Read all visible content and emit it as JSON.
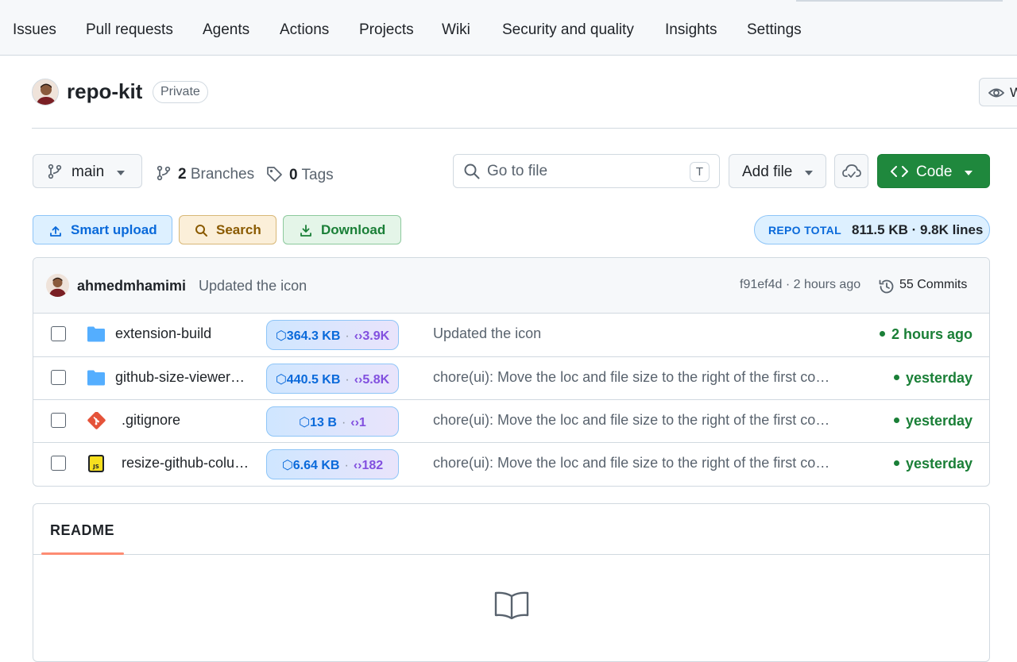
{
  "nav": {
    "items": [
      {
        "label": "Issues"
      },
      {
        "label": "Pull requests"
      },
      {
        "label": "Agents"
      },
      {
        "label": "Actions"
      },
      {
        "label": "Projects"
      },
      {
        "label": "Wiki"
      },
      {
        "label": "Security and quality"
      },
      {
        "label": "Insights"
      },
      {
        "label": "Settings"
      }
    ]
  },
  "repo": {
    "name": "repo-kit",
    "visibility": "Private",
    "watch_label": "W"
  },
  "toolbar": {
    "branch": "main",
    "branches_count": "2",
    "branches_label": "Branches",
    "tags_count": "0",
    "tags_label": "Tags",
    "goto_placeholder": "Go to file",
    "goto_shortcut": "T",
    "add_file": "Add file",
    "code": "Code"
  },
  "actions": {
    "smart_upload": "Smart upload",
    "search": "Search",
    "download": "Download",
    "repo_total_label": "REPO TOTAL",
    "repo_total_value": "811.5 KB · 9.8K lines"
  },
  "latest_commit": {
    "author": "ahmedmhamimi",
    "message": "Updated the icon",
    "sha_time": "f91ef4d · 2 hours ago",
    "commits": "55 Commits"
  },
  "files": [
    {
      "name": "extension-build",
      "type": "folder",
      "size": "364.3 KB",
      "loc": "3.9K",
      "commit": "Updated the icon",
      "age": "2 hours ago"
    },
    {
      "name": "github-size-viewer…",
      "type": "folder",
      "size": "440.5 KB",
      "loc": "5.8K",
      "commit": "chore(ui): Move the loc and file size to the right of the first co…",
      "age": "yesterday"
    },
    {
      "name": ".gitignore",
      "type": "git",
      "size": "13 B",
      "loc": "1",
      "commit": "chore(ui): Move the loc and file size to the right of the first co…",
      "age": "yesterday"
    },
    {
      "name": "resize-github-colu…",
      "type": "js",
      "size": "6.64 KB",
      "loc": "182",
      "commit": "chore(ui): Move the loc and file size to the right of the first co…",
      "age": "yesterday"
    }
  ],
  "readme": {
    "tab": "README"
  },
  "colors": {
    "accent_green": "#1f883d",
    "link_blue": "#0969da",
    "loc_purple": "#8250df",
    "readme_tab_underline": "#fd8c73"
  }
}
